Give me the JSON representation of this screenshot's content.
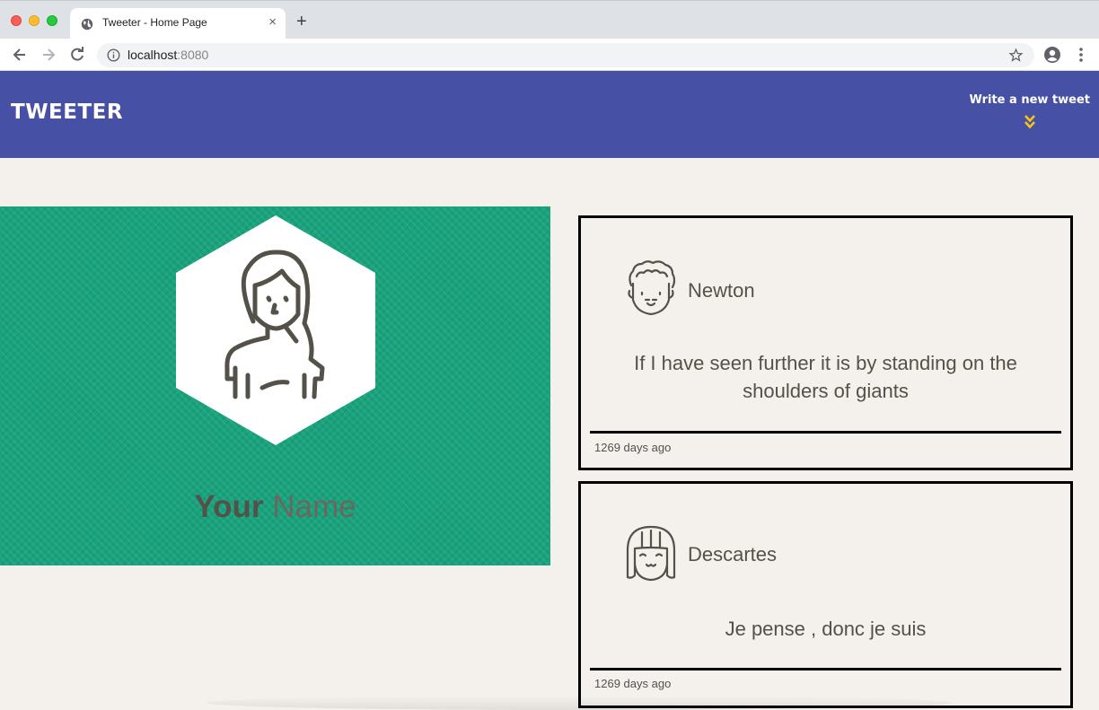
{
  "browser": {
    "tab_title": "Tweeter - Home Page",
    "tab_close": "×",
    "new_tab": "+",
    "url_host": "localhost",
    "url_port": ":8080"
  },
  "nav": {
    "logo": "TWEETER",
    "compose_label": "Write a new tweet",
    "accent_color": "#4650a4",
    "chevron_color": "#f5c518"
  },
  "profile": {
    "name_first": "Your",
    "name_last": " Name",
    "background_color": "#18a37c"
  },
  "tweets": [
    {
      "author": "Newton",
      "avatar_icon": "curly-hair-man-avatar-icon",
      "text": "If I have seen further it is by standing on the shoulders of giants",
      "time": "1269 days ago"
    },
    {
      "author": "Descartes",
      "avatar_icon": "bob-hair-avatar-icon",
      "text": "Je pense , donc je suis",
      "time": "1269 days ago"
    }
  ]
}
